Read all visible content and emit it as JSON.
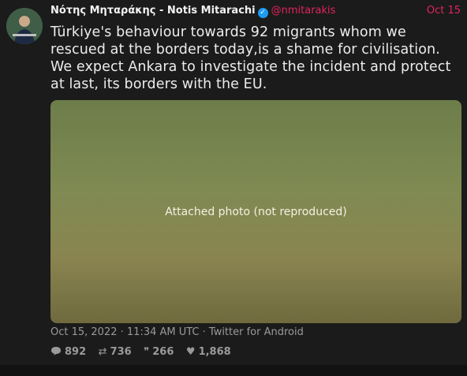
{
  "tweet": {
    "author_name": "Νότης Μηταράκης - Notis Mitarachi",
    "handle": "@nmitarakis",
    "date_short": "Oct 15",
    "text": "Türkiye's behaviour towards 92 migrants whom we rescued at the borders today,is a shame for civilisation. We expect Ankara to investigate the incident and protect at last, its borders with the EU.",
    "timestamp": "Oct 15, 2022 · 11:34 AM UTC · Twitter for Android",
    "stats": {
      "replies": "892",
      "retweets": "736",
      "quotes": "266",
      "likes": "1,868"
    },
    "media_note": "Attached photo (not reproduced)"
  },
  "icons": {
    "verified": "verified-badge-icon",
    "reply": "reply-icon",
    "retweet": "retweet-icon",
    "quote": "quote-icon",
    "like": "heart-icon"
  },
  "colors": {
    "background": "#1b1b1b",
    "accent": "#e0245e",
    "verified": "#1d9bf0",
    "muted": "#9a9a9a"
  }
}
